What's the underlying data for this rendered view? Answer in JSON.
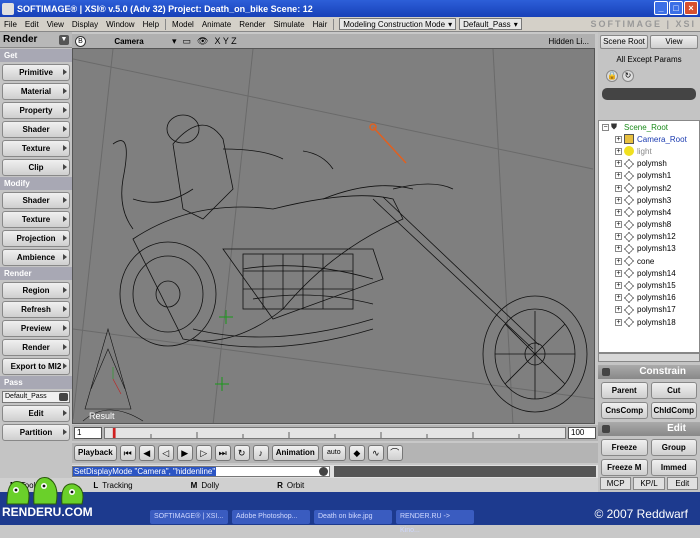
{
  "window": {
    "title": "SOFTIMAGE® | XSI® v.5.0 (Adv 32) Project: Death_on_bike    Scene: 12",
    "logo": "SOFTIMAGE | XSI"
  },
  "menu": {
    "items": [
      "File",
      "Edit",
      "View",
      "Display",
      "Window",
      "Help",
      "Model",
      "Animate",
      "Render",
      "Simulate",
      "Hair"
    ],
    "mode": "Modeling Construction Mode",
    "pass": "Default_Pass"
  },
  "left": {
    "title": "Render",
    "sections": [
      {
        "title": "Get",
        "buttons": [
          "Primitive",
          "Material",
          "Property",
          "Shader",
          "Texture",
          "Clip"
        ]
      },
      {
        "title": "Modify",
        "buttons": [
          "Shader",
          "Texture",
          "Projection",
          "Ambience"
        ]
      },
      {
        "title": "Render",
        "buttons": [
          "Region",
          "Refresh",
          "Preview",
          "Render",
          "Export to MI2"
        ]
      },
      {
        "title": "Pass",
        "buttons": [
          "Edit",
          "Partition"
        ]
      }
    ],
    "pass_combo": "Default_Pass"
  },
  "viewport": {
    "header": {
      "label": "B",
      "camera": "Camera",
      "axes": "X Y Z",
      "mode": "Hidden Li..."
    },
    "result_label": "Result"
  },
  "explorer": {
    "scene_root_btn": "Scene Root",
    "view_btn": "View",
    "filter": "All Except Params",
    "items": [
      {
        "label": "Scene_Root",
        "color": "#1a8a1a",
        "icon": "root"
      },
      {
        "label": "Camera_Root",
        "color": "#1a3ab0",
        "icon": "camera"
      },
      {
        "label": "light",
        "color": "#888888",
        "icon": "light"
      },
      {
        "label": "polymsh",
        "color": "#000000",
        "icon": "mesh"
      },
      {
        "label": "polymsh1",
        "color": "#000000",
        "icon": "mesh"
      },
      {
        "label": "polymsh2",
        "color": "#000000",
        "icon": "mesh"
      },
      {
        "label": "polymsh3",
        "color": "#000000",
        "icon": "mesh"
      },
      {
        "label": "polymsh4",
        "color": "#000000",
        "icon": "mesh"
      },
      {
        "label": "polymsh8",
        "color": "#000000",
        "icon": "mesh"
      },
      {
        "label": "polymsh12",
        "color": "#000000",
        "icon": "mesh"
      },
      {
        "label": "polymsh13",
        "color": "#000000",
        "icon": "mesh"
      },
      {
        "label": "cone",
        "color": "#000000",
        "icon": "mesh"
      },
      {
        "label": "polymsh14",
        "color": "#000000",
        "icon": "mesh"
      },
      {
        "label": "polymsh15",
        "color": "#000000",
        "icon": "mesh"
      },
      {
        "label": "polymsh16",
        "color": "#000000",
        "icon": "mesh"
      },
      {
        "label": "polymsh17",
        "color": "#000000",
        "icon": "mesh"
      },
      {
        "label": "polymsh18",
        "color": "#000000",
        "icon": "mesh"
      }
    ]
  },
  "constrain": {
    "title": "Constrain",
    "buttons": [
      "Parent",
      "Cut",
      "CnsComp",
      "ChldComp"
    ]
  },
  "edit": {
    "title": "Edit",
    "buttons": [
      "Freeze",
      "Group",
      "Freeze M",
      "Immed"
    ]
  },
  "bottom_tabs": [
    "MCP",
    "KP/L",
    "Edit"
  ],
  "timeline": {
    "start": "1",
    "end": "100"
  },
  "playback": {
    "label": "Playback",
    "animation": "Animation",
    "auto": "auto"
  },
  "command": "SetDisplayMode \"Camera\", \"hiddenline\"",
  "status": {
    "items": [
      "Tool",
      "Tracking",
      "Dolly",
      "Orbit"
    ],
    "mouse_keys": [
      "M",
      "L",
      "M",
      "R"
    ]
  },
  "watermark": {
    "brand": "RENDERU.COM",
    "copyright": "© 2007 Reddwarf"
  },
  "taskbar": [
    "SOFTIMAGE® | XSI...",
    "Adobe Photoshop...",
    "Death on bike.jpg",
    "RENDER.RU -> Kino..."
  ]
}
